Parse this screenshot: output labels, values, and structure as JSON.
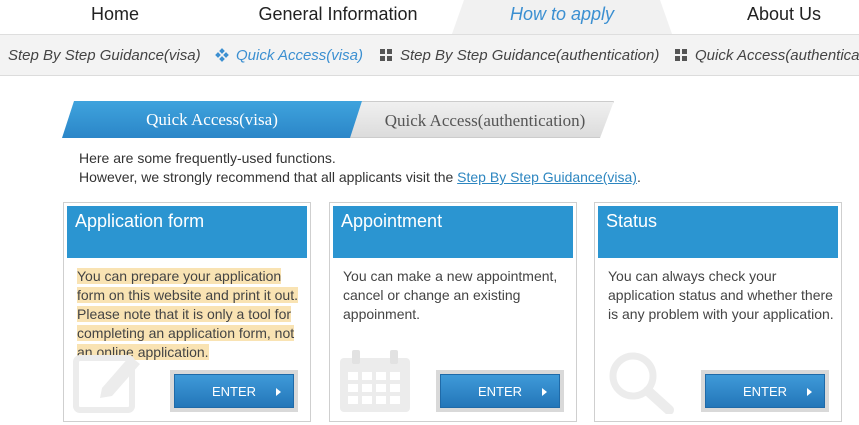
{
  "topnav": {
    "tabs": [
      {
        "label": "Home"
      },
      {
        "label": "General Information"
      },
      {
        "label": "How to apply",
        "active": true
      },
      {
        "label": "About Us"
      }
    ]
  },
  "subnav": {
    "items": [
      {
        "label": "Step By Step Guidance(visa)",
        "icon": "grid-icon"
      },
      {
        "label": "Quick Access(visa)",
        "icon": "diamond-icon",
        "active": true
      },
      {
        "label": "Step By Step Guidance(authentication)",
        "icon": "grid-icon"
      },
      {
        "label": "Quick Access(authentication)",
        "icon": "grid-icon"
      }
    ]
  },
  "subtabs": {
    "active": "Quick Access(visa)",
    "inactive": "Quick Access(authentication)"
  },
  "intro": {
    "line1": "Here are some frequently-used functions.",
    "line2_prefix": "However, we strongly recommend that all applicants visit the ",
    "line2_link": "Step By Step Guidance(visa)",
    "line2_suffix": "."
  },
  "cards": [
    {
      "title": "Application form",
      "desc_lines": [
        "You can prepare your application",
        "form on this website and print it out.",
        "Please note that it is only a tool for",
        "completing an application form, not",
        "an online application."
      ],
      "button": "ENTER",
      "icon": "pencil-note-icon"
    },
    {
      "title": "Appointment",
      "desc": "You can make a new appointment, cancel or change an existing appoinment.",
      "button": "ENTER",
      "icon": "calendar-icon"
    },
    {
      "title": "Status",
      "desc": "You can always check your application status and whether there is any problem with your application.",
      "button": "ENTER",
      "icon": "magnifier-icon"
    }
  ],
  "colors": {
    "accent": "#2b95d1",
    "active_nav": "#3b8fd1",
    "highlight": "#f9e3b3"
  }
}
